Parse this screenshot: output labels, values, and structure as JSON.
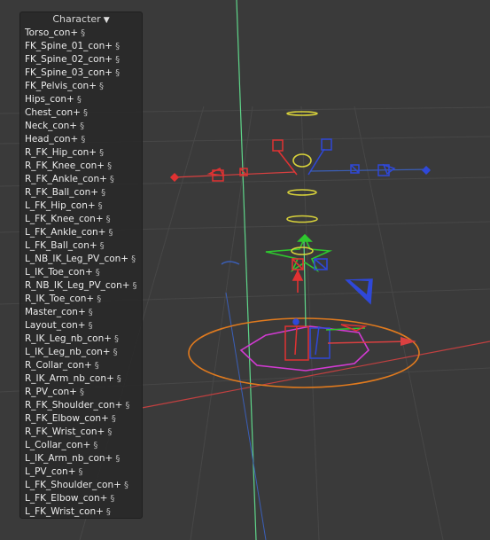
{
  "panel": {
    "title": "Character",
    "dropdown_icon": "chevron-down-icon",
    "link_icon": "link-icon",
    "link_glyph": "§",
    "controls": [
      "Torso_con+",
      "FK_Spine_01_con+",
      "FK_Spine_02_con+",
      "FK_Spine_03_con+",
      "FK_Pelvis_con+",
      "Hips_con+",
      "Chest_con+",
      "Neck_con+",
      "Head_con+",
      "R_FK_Hip_con+",
      "R_FK_Knee_con+",
      "R_FK_Ankle_con+",
      "R_FK_Ball_con+",
      "L_FK_Hip_con+",
      "L_FK_Knee_con+",
      "L_FK_Ankle_con+",
      "L_FK_Ball_con+",
      "L_NB_IK_Leg_PV_con+",
      "L_IK_Toe_con+",
      "R_NB_IK_Leg_PV_con+",
      "R_IK_Toe_con+",
      "Master_con+",
      "Layout_con+",
      "R_IK_Leg_nb_con+",
      "L_IK_Leg_nb_con+",
      "R_Collar_con+",
      "R_IK_Arm_nb_con+",
      "R_PV_con+",
      "R_FK_Shoulder_con+",
      "R_FK_Elbow_con+",
      "R_FK_Wrist_con+",
      "L_Collar_con+",
      "L_IK_Arm_nb_con+",
      "L_PV_con+",
      "L_FK_Shoulder_con+",
      "L_FK_Elbow_con+",
      "L_FK_Wrist_con+"
    ]
  },
  "viewport": {
    "colors": {
      "background": "#3a3a3a",
      "grid": "#474747",
      "y_axis": "#5fd68a",
      "x_axis": "#d94040",
      "z_axis": "#3b5fb8",
      "torso_rings": "#d8d23a",
      "right_side": "#e03232",
      "left_side": "#2f48d8",
      "master": "#e07a1e",
      "layout": "#d23ad2",
      "hips": "#2ec82e"
    }
  }
}
